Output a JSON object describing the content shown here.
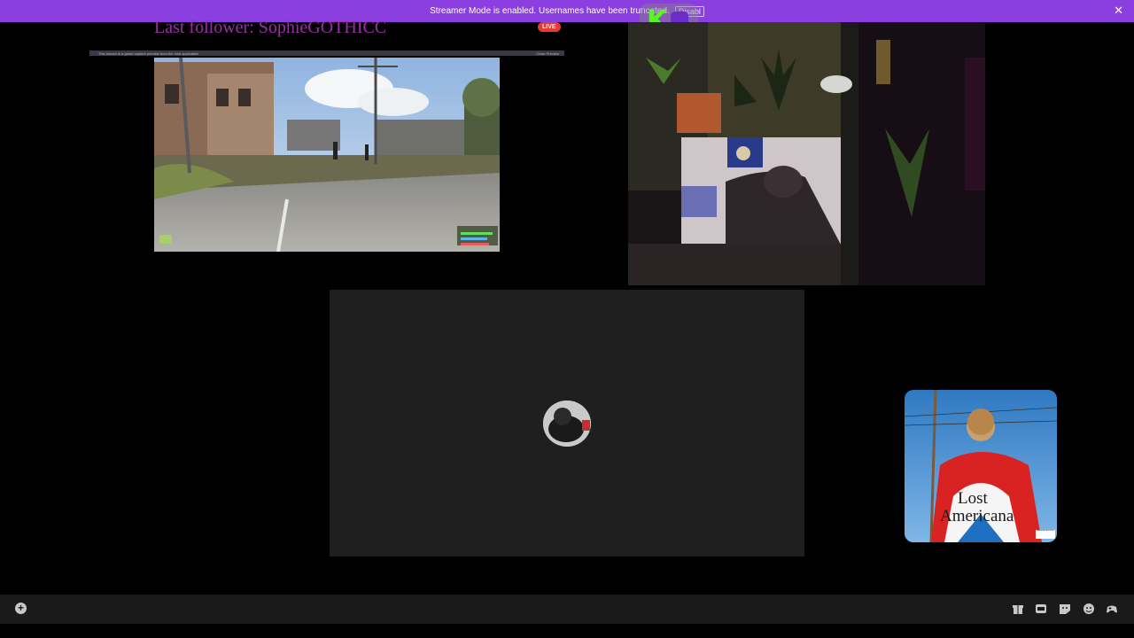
{
  "banner": {
    "message": "Streamer Mode is enabled. Usernames have been truncated.",
    "link_label": "Disabl",
    "close_icon": "close-icon"
  },
  "overlay": {
    "follower_text": "Last follower: SophieGOTHICC",
    "live_label": "LIVE",
    "notice_text": "This stream is a game capture preview from the host application",
    "notice_action": "Close Preview"
  },
  "call": {
    "avatar": "user-avatar"
  },
  "album": {
    "title_line1": "Lost",
    "title_line2": "Americana",
    "advisory": "PARENTAL ADVISORY"
  },
  "bottom_bar": {
    "add_icon": "plus-circle-icon",
    "icons": [
      "gift-icon",
      "gif-icon",
      "sticker-icon",
      "emoji-icon",
      "gamepad-icon"
    ]
  },
  "colors": {
    "banner": "#8b3fe0",
    "follower_text": "#9a2ea6",
    "live": "#e53935",
    "panel": "#1f1f1f",
    "bottom_bar": "#1a1a1a",
    "kick_green": "#53fc18"
  }
}
